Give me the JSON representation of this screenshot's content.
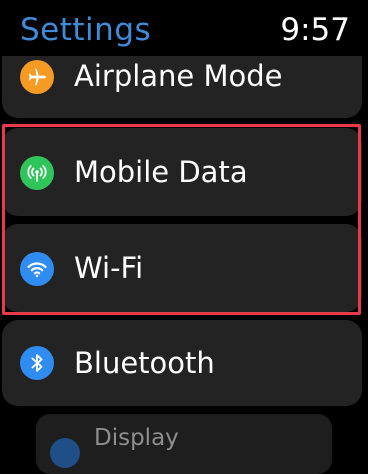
{
  "header": {
    "title": "Settings",
    "time": "9:57"
  },
  "settings": {
    "airplane_mode": {
      "label": "Airplane Mode",
      "icon": "airplane-icon",
      "color": "#f59a23"
    },
    "mobile_data": {
      "label": "Mobile Data",
      "icon": "cellular-antenna-icon",
      "color": "#30c55a"
    },
    "wifi": {
      "label": "Wi-Fi",
      "icon": "wifi-icon",
      "color": "#2f8cf0"
    },
    "bluetooth": {
      "label": "Bluetooth",
      "icon": "bluetooth-icon",
      "color": "#2f8cf0"
    },
    "display": {
      "label": "Display",
      "icon": "display-icon",
      "color": "#1f4f86"
    }
  },
  "highlight": {
    "color": "#e83a4a"
  }
}
